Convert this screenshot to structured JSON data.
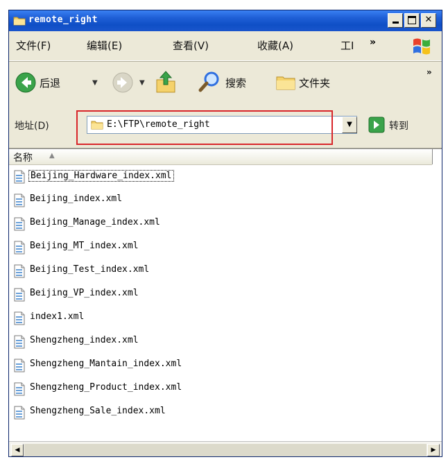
{
  "window": {
    "title": "remote_right"
  },
  "menubar": {
    "items": [
      "文件(F)",
      "编辑(E)",
      "查看(V)",
      "收藏(A)",
      "工I"
    ],
    "overflow": "»"
  },
  "toolbar": {
    "back_label": "后退",
    "search_label": "搜索",
    "folders_label": "文件夹",
    "overflow": "»"
  },
  "address": {
    "label": "地址(D)",
    "path": "E:\\FTP\\remote_right",
    "go_label": "转到"
  },
  "list": {
    "column_name": "名称",
    "files": [
      "Beijing_Hardware_index.xml",
      "Beijing_index.xml",
      "Beijing_Manage_index.xml",
      "Beijing_MT_index.xml",
      "Beijing_Test_index.xml",
      "Beijing_VP_index.xml",
      "index1.xml",
      "Shengzheng_index.xml",
      "Shengzheng_Mantain_index.xml",
      "Shengzheng_Product_index.xml",
      "Shengzheng_Sale_index.xml"
    ]
  },
  "colors": {
    "titlebar": "#1f5fd6",
    "chrome": "#ece9d8",
    "highlight": "#d8252a"
  }
}
